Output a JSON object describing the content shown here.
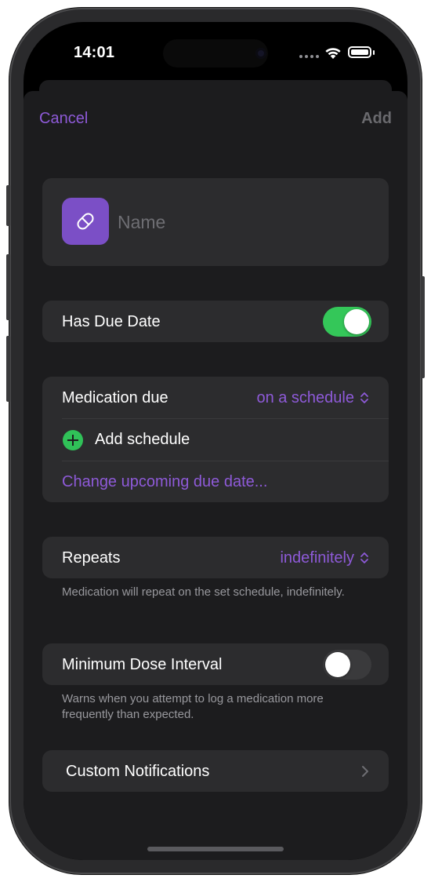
{
  "status_bar": {
    "time": "14:01",
    "wifi_icon": "wifi-icon",
    "battery_icon": "battery-icon"
  },
  "nav": {
    "cancel_label": "Cancel",
    "add_label": "Add"
  },
  "name_card": {
    "icon": "pill-icon",
    "icon_color": "#7b4fc6",
    "name_placeholder": "Name",
    "name_value": ""
  },
  "due_date": {
    "label": "Has Due Date",
    "enabled": true
  },
  "schedule": {
    "label": "Medication due",
    "value": "on a schedule",
    "add_schedule_label": "Add schedule",
    "change_due_label": "Change upcoming due date..."
  },
  "repeats": {
    "label": "Repeats",
    "value": "indefinitely",
    "footnote": "Medication will repeat on the set schedule, indefinitely."
  },
  "min_dose": {
    "label": "Minimum Dose Interval",
    "enabled": false,
    "footnote": "Warns when you attempt to log a medication more frequently than expected."
  },
  "notifications": {
    "label": "Custom Notifications"
  },
  "colors": {
    "accent": "#8e5ad8",
    "toggle_on": "#34c759",
    "add_green": "#30c158",
    "background": "#1c1c1e",
    "cell": "#2c2c2e"
  }
}
